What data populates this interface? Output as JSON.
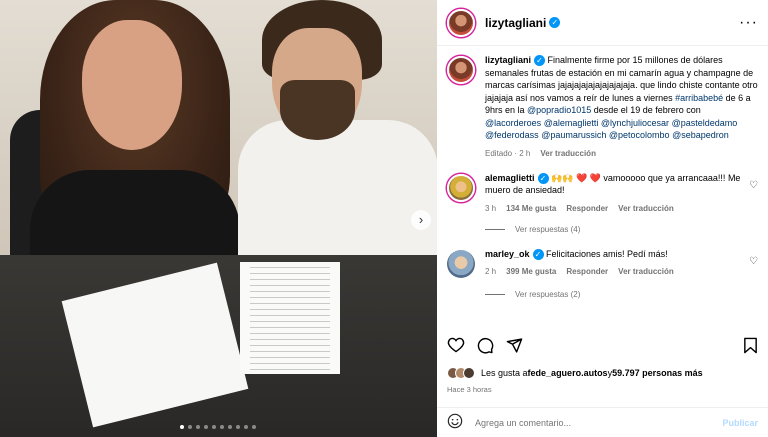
{
  "post": {
    "username": "lizytagliani",
    "more_icon": "more-horizontal-icon"
  },
  "caption": {
    "username": "lizytagliani",
    "text_plain": " Finalmente firme por 15 millones de dólares semanales frutas de estación en mi camarín agua y champagne de marcas carísimas jajajajajajajajajajaja. que lindo chiste contante otro jajajaja así nos vamos a reír de lunes a viernes ",
    "hashtag": "#arribabebé",
    "text2": " de 6 a 9hrs en la ",
    "mention_radio": "@popradio1015",
    "text3": " desde el 19 de febrero con ",
    "m1": "@lacorderoes",
    "m2": "@alemaglietti",
    "m3": "@lynchjuliocesar",
    "m4": "@pasteldedamo",
    "m5": "@federodass",
    "m6": "@paumarussich",
    "m7": "@petocolombo",
    "m8": "@sebapedron",
    "edited": "Editado · 2 h",
    "see_translation": "Ver traducción"
  },
  "comments": [
    {
      "username": "alemaglietti",
      "text": " 🙌🙌 ❤️ ❤️ vamooooo que ya arrancaaa!!! Me muero de ansiedad!",
      "time": "3 h",
      "likes": "134 Me gusta",
      "reply": "Responder",
      "translate": "Ver traducción",
      "replies": "Ver respuestas (4)"
    },
    {
      "username": "marley_ok",
      "text": " Felicitaciones amis! Pedí más!",
      "time": "2 h",
      "likes": "399 Me gusta",
      "reply": "Responder",
      "translate": "Ver traducción",
      "replies": "Ver respuestas (2)"
    }
  ],
  "likes_prefix": "Les gusta a ",
  "likes_user": "fede_aguero.autos",
  "likes_middle": " y ",
  "likes_count": "59.797 personas más",
  "posted_time": "Hace 3 horas",
  "add_comment": {
    "placeholder": "Agrega un comentario...",
    "post_label": "Publicar"
  },
  "carousel": {
    "total": 10,
    "active": 0
  },
  "colors": {
    "verified": "#0095f6",
    "link": "#00376b",
    "meta": "#737373",
    "accent": "#d6249f"
  }
}
